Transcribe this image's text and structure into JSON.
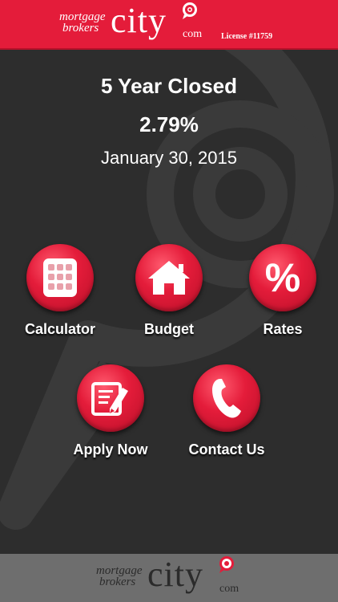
{
  "header": {
    "logo_small_1": "mortgage",
    "logo_small_2": "brokers",
    "logo_big": "city",
    "logo_com": "com",
    "license": "License #11759"
  },
  "rate": {
    "title": "5 Year Closed",
    "value": "2.79%",
    "date": "January 30, 2015"
  },
  "tiles": [
    {
      "label": "Calculator",
      "icon": "calculator-icon"
    },
    {
      "label": "Budget",
      "icon": "house-icon"
    },
    {
      "label": "Rates",
      "icon": "percent-icon",
      "glyph": "%"
    },
    {
      "label": "Apply Now",
      "icon": "form-pencil-icon"
    },
    {
      "label": "Contact Us",
      "icon": "phone-icon"
    }
  ],
  "footer": {
    "logo_small_1": "mortgage",
    "logo_small_2": "brokers",
    "logo_big": "city",
    "logo_com": "com"
  },
  "colors": {
    "brand_red": "#e41c3a",
    "background": "#2d2d2d",
    "footer": "#6e6e6e"
  }
}
